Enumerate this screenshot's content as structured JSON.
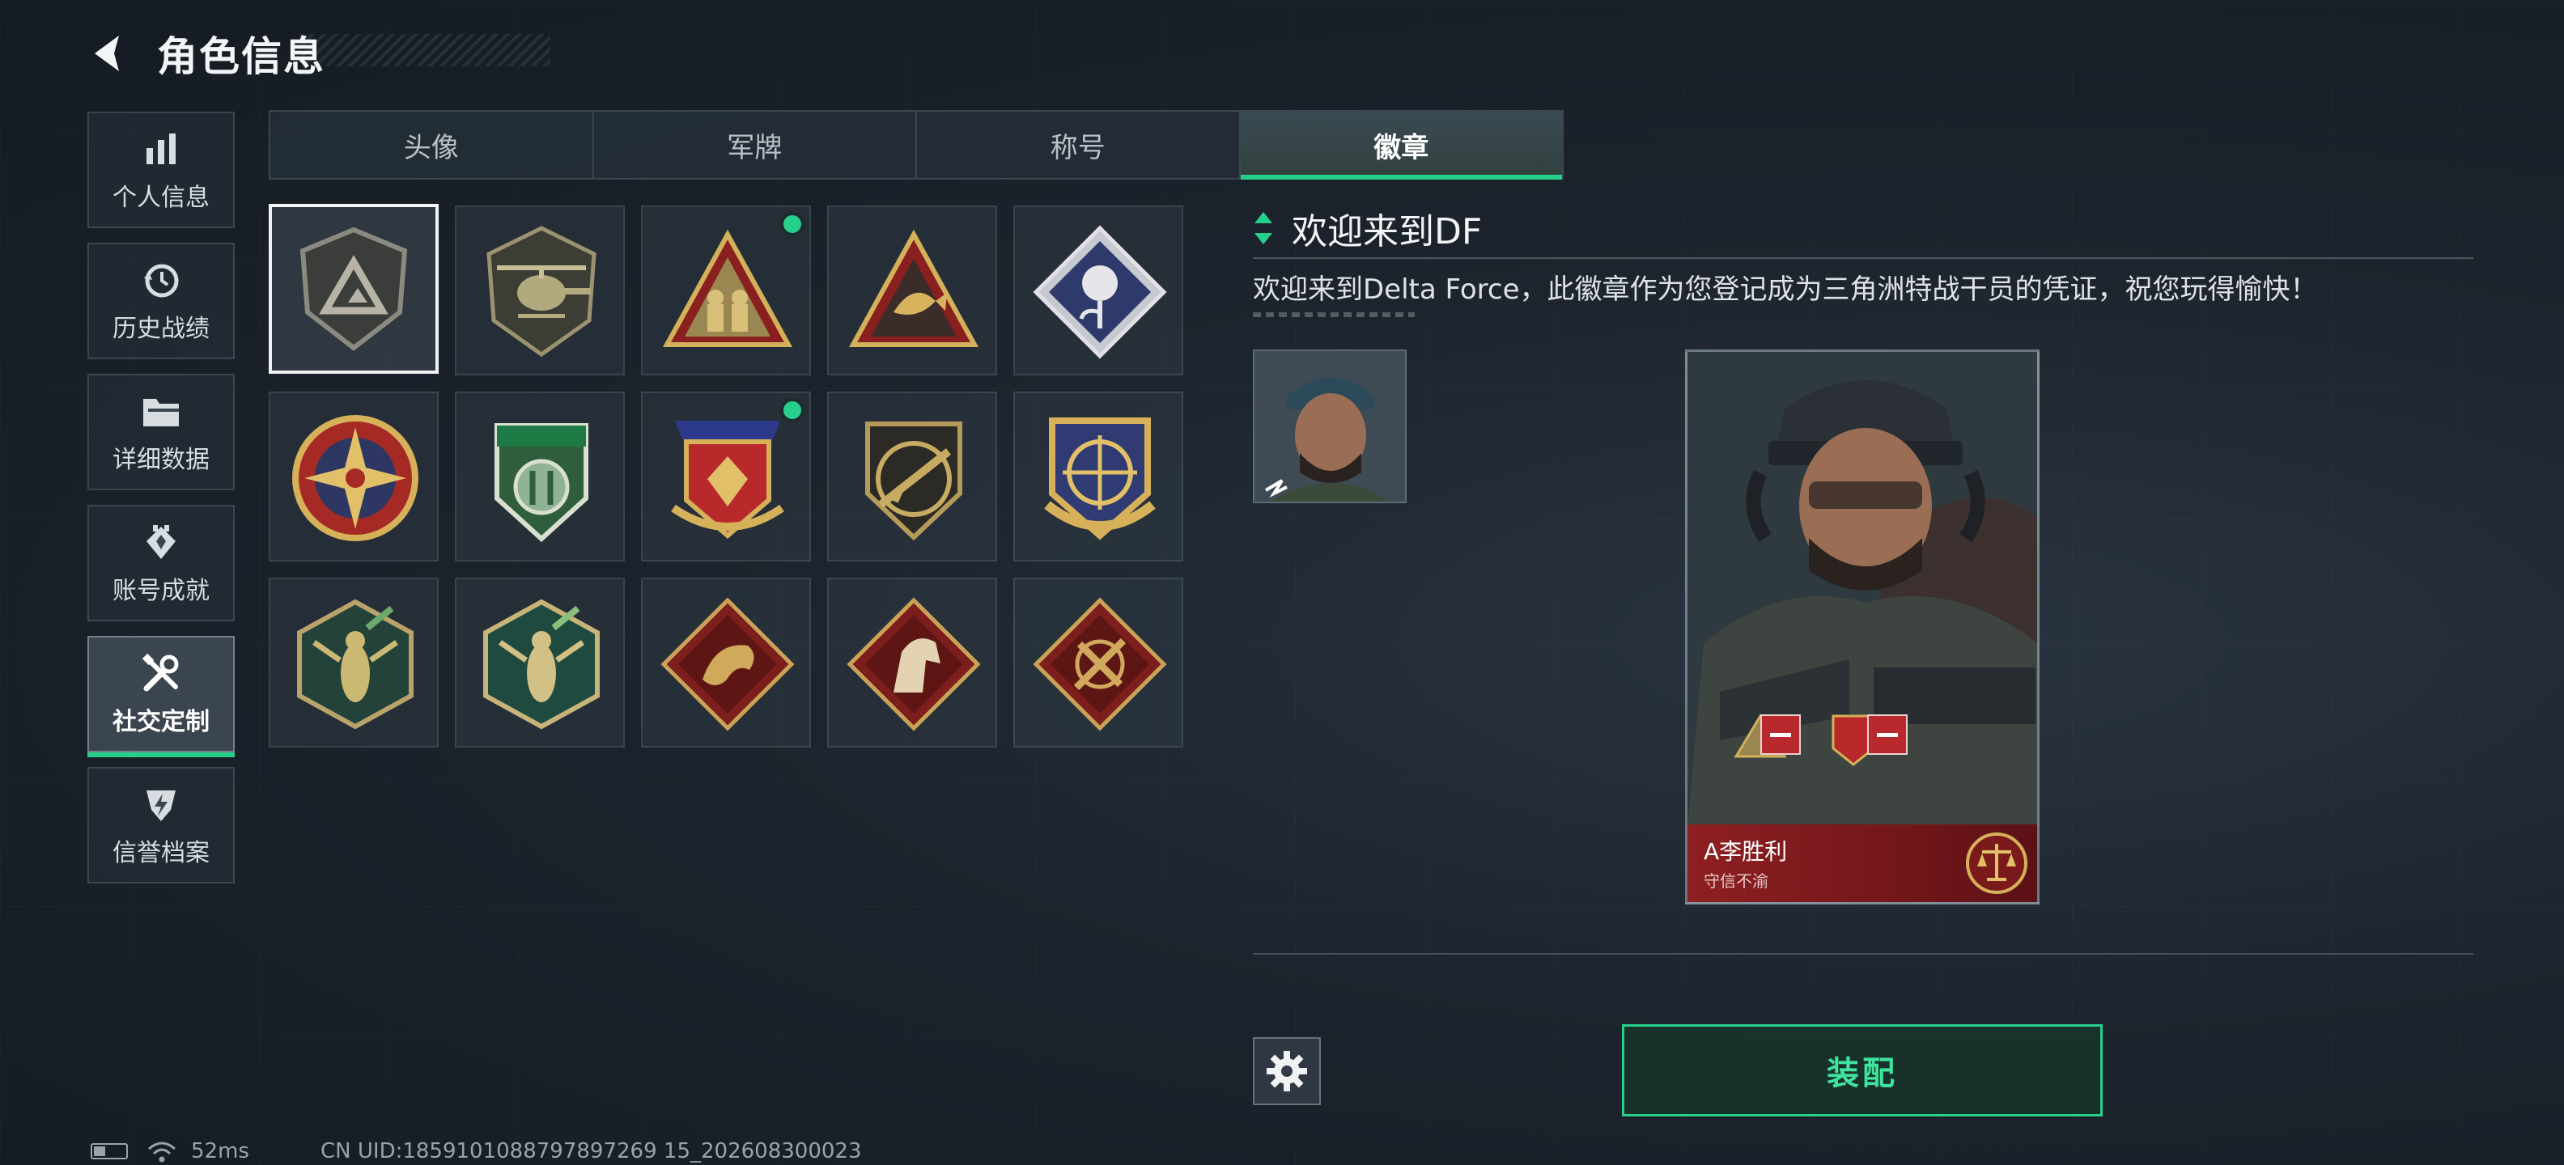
{
  "header": {
    "title": "角色信息"
  },
  "sidebar": {
    "items": [
      {
        "label": "个人信息",
        "icon": "bar-chart-icon"
      },
      {
        "label": "历史战绩",
        "icon": "history-clock-icon"
      },
      {
        "label": "详细数据",
        "icon": "folder-icon"
      },
      {
        "label": "账号成就",
        "icon": "achievement-icon"
      },
      {
        "label": "社交定制",
        "icon": "tools-icon",
        "active": true
      },
      {
        "label": "信誉档案",
        "icon": "shield-lightning-icon"
      }
    ]
  },
  "tabs": [
    {
      "label": "头像"
    },
    {
      "label": "军牌"
    },
    {
      "label": "称号"
    },
    {
      "label": "徽章",
      "active": true
    }
  ],
  "badges": [
    {
      "icon": "delta-shield-badge-icon",
      "selected": true,
      "new": false
    },
    {
      "icon": "helicopter-badge-icon",
      "new": false
    },
    {
      "icon": "soldiers-triangle-badge-icon",
      "new": true
    },
    {
      "icon": "fish-triangle-badge-icon",
      "new": false
    },
    {
      "icon": "rose-diamond-badge-icon",
      "new": false
    },
    {
      "icon": "star-compass-badge-icon",
      "new": false
    },
    {
      "icon": "green-crest-badge-icon",
      "new": false
    },
    {
      "icon": "red-crest-badge-icon",
      "new": true
    },
    {
      "icon": "rifle-badge-icon",
      "new": false
    },
    {
      "icon": "crosshair-crest-badge-icon",
      "new": false
    },
    {
      "icon": "wasp-hexagon-badge-icon",
      "new": false
    },
    {
      "icon": "wasp-hexagon-green-badge-icon",
      "new": false
    },
    {
      "icon": "dragon-diamond-badge-icon",
      "new": false
    },
    {
      "icon": "horse-diamond-badge-icon",
      "new": false
    },
    {
      "icon": "tools-diamond-badge-icon",
      "new": false
    }
  ],
  "detail": {
    "title": "欢迎来到DF",
    "description": "欢迎来到Delta Force，此徽章作为您登记成为三角洲特战干员的凭证，祝您玩得愉快！"
  },
  "card": {
    "player_name": "A李胜利",
    "player_subtitle": "守信不渝"
  },
  "actions": {
    "equip_label": "装配"
  },
  "status_bar": {
    "ping": "52ms",
    "uid": "CN UID:1859101088797897269 15_202608300023"
  },
  "colors": {
    "accent": "#27d08a",
    "card_red": "#8e1f22",
    "gold": "#c9a24a"
  }
}
